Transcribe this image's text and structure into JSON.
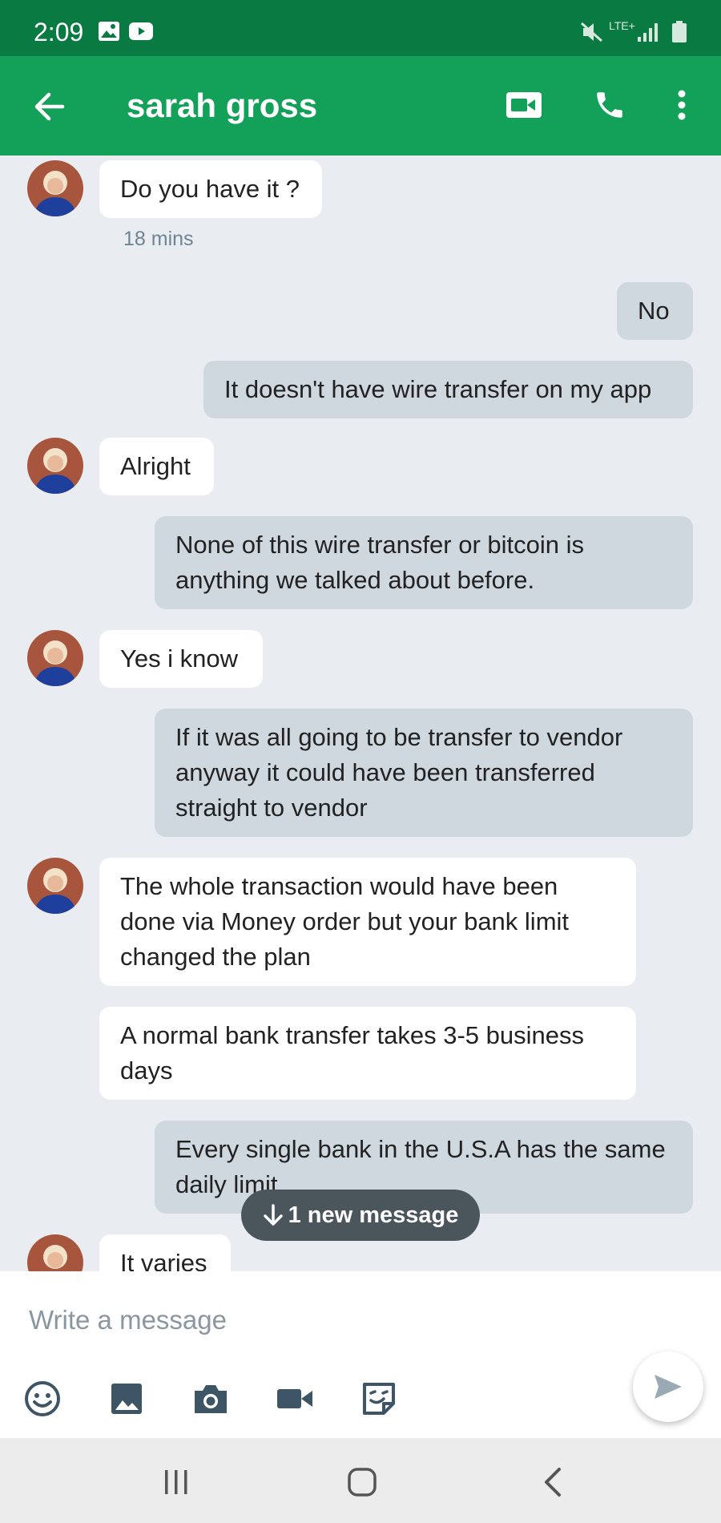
{
  "status_bar": {
    "time": "2:09",
    "network": "LTE+"
  },
  "header": {
    "contact_name": "sarah gross"
  },
  "messages": [
    {
      "direction": "incoming",
      "text": "Do you have it ?",
      "timestamp": "18 mins"
    },
    {
      "direction": "outgoing",
      "text": "No"
    },
    {
      "direction": "outgoing",
      "text": "It doesn't have wire transfer on my app"
    },
    {
      "direction": "incoming",
      "text": "Alright"
    },
    {
      "direction": "outgoing",
      "text": "None of this wire transfer or bitcoin is anything we talked about before."
    },
    {
      "direction": "incoming",
      "text": "Yes i know"
    },
    {
      "direction": "outgoing",
      "text": "If it was all going to be transfer to vendor anyway it could have been transferred straight to vendor"
    },
    {
      "direction": "incoming",
      "text": "The whole transaction would have been done via Money order but your bank limit changed the plan"
    },
    {
      "direction": "incoming",
      "text": "A normal bank transfer takes 3-5 business days"
    },
    {
      "direction": "outgoing",
      "text": "Every single bank in the U.S.A has the same daily limit."
    },
    {
      "direction": "incoming",
      "text": "It varies"
    }
  ],
  "new_message_pill": "1 new message",
  "composer": {
    "placeholder": "Write a message"
  },
  "colors": {
    "status_bar": "#0a7a43",
    "app_bar": "#13a058",
    "outgoing_bubble": "#cfd8de",
    "incoming_bubble": "#ffffff",
    "chat_bg": "#e9edf1"
  }
}
